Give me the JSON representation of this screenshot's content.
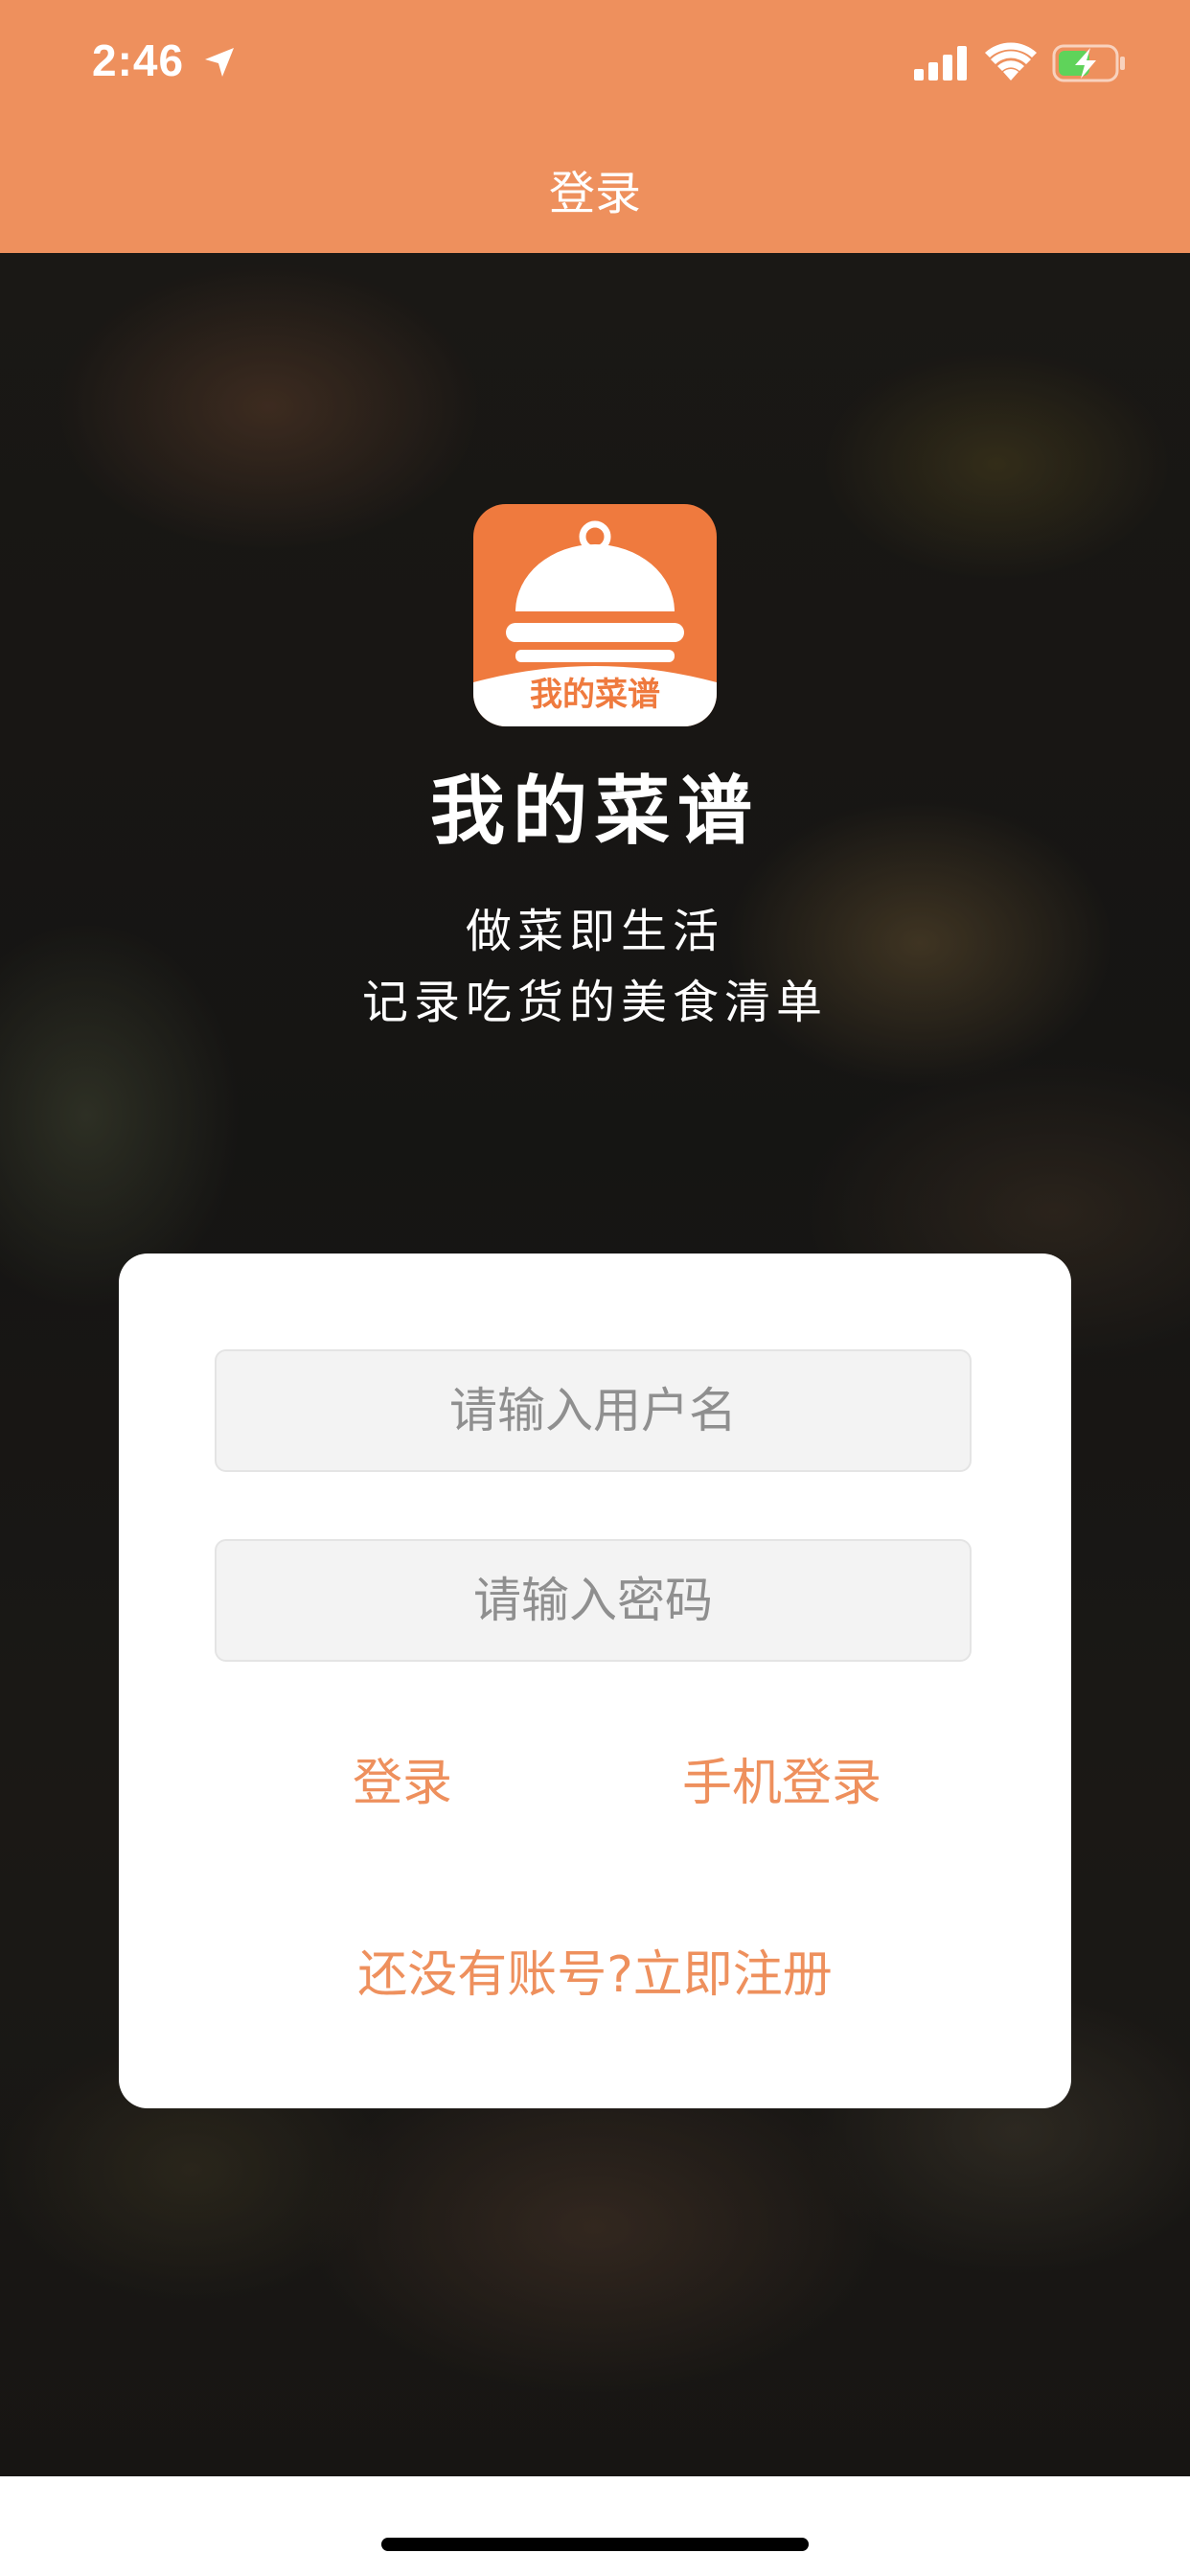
{
  "status_bar": {
    "time": "2:46",
    "background_color": "#ee905d",
    "icons": [
      "location-arrow-icon",
      "signal-icon",
      "wifi-icon",
      "battery-charging-icon"
    ]
  },
  "nav": {
    "title": "登录"
  },
  "hero": {
    "logo_text": "我的菜谱",
    "app_name": "我的菜谱",
    "slogan_line1": "做菜即生活",
    "slogan_line2": "记录吃货的美食清单",
    "logo_icon": "serving-cloche-icon",
    "accent_color": "#ef7a3e"
  },
  "login_form": {
    "username_placeholder": "请输入用户名",
    "password_placeholder": "请输入密码",
    "login_label": "登录",
    "phone_login_label": "手机登录",
    "register_label": "还没有账号?立即注册",
    "link_color": "#ee905d"
  }
}
